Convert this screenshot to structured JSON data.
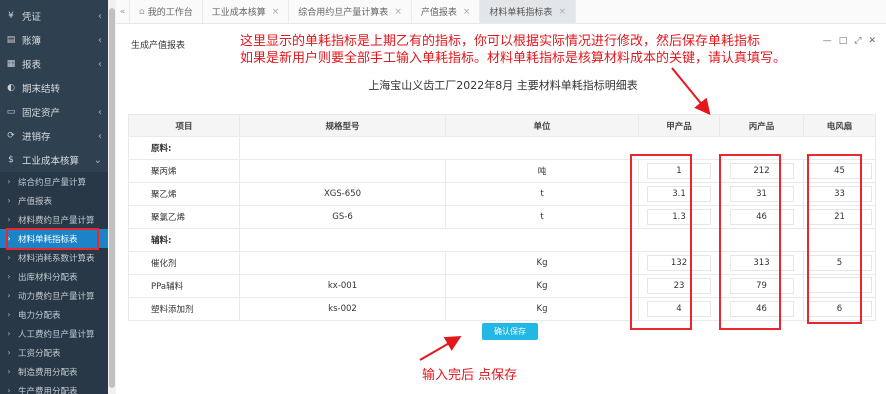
{
  "sidebar": {
    "top_items": [
      {
        "label": "凭证",
        "icon": "¥",
        "icon_name": "yen-icon"
      },
      {
        "label": "账簿",
        "icon": "▤",
        "icon_name": "book-icon"
      },
      {
        "label": "报表",
        "icon": "▦",
        "icon_name": "report-icon"
      },
      {
        "label": "期末结转",
        "icon": "◐",
        "icon_name": "period-close-icon"
      },
      {
        "label": "固定资产",
        "icon": "▭",
        "icon_name": "fixed-asset-icon"
      },
      {
        "label": "进销存",
        "icon": "⟳",
        "icon_name": "inventory-icon"
      },
      {
        "label": "工业成本核算",
        "icon": "$",
        "icon_name": "dollar-icon"
      }
    ],
    "sub_items": [
      "综合约旦产量计算",
      "产值报表",
      "材料费约旦产量计算",
      "材料单耗指标表",
      "材料消耗系数计算表",
      "出库材料分配表",
      "动力费约旦产量计算",
      "电力分配表",
      "人工费约旦产量计算",
      "工资分配表",
      "制造费用分配表",
      "生产费用分配表"
    ]
  },
  "tabs": [
    {
      "label": "我的工作台"
    },
    {
      "label": "工业成本核算"
    },
    {
      "label": "综合用约旦产量计算表"
    },
    {
      "label": "产值报表"
    },
    {
      "label": "材料单耗指标表"
    }
  ],
  "panel": {
    "title": "生成产值报表",
    "report_title": "上海宝山义齿工厂2022年8月 主要材料单耗指标明细表",
    "tools": [
      "—",
      "□",
      "⤢",
      "✕"
    ]
  },
  "table": {
    "headers": [
      "项目",
      "规格型号",
      "单位",
      "甲产品",
      "丙产品",
      "电风扇"
    ],
    "sections": [
      {
        "label": "原料:",
        "rows": [
          {
            "name": "聚丙烯",
            "spec": "",
            "unit": "吨",
            "values": [
              "1",
              "212",
              "45"
            ]
          },
          {
            "name": "聚乙烯",
            "spec": "XGS-650",
            "unit": "t",
            "values": [
              "3.1",
              "31",
              "33"
            ]
          },
          {
            "name": "聚氯乙烯",
            "spec": "GS-6",
            "unit": "t",
            "values": [
              "1.3",
              "46",
              "21"
            ]
          }
        ]
      },
      {
        "label": "辅料:",
        "rows": [
          {
            "name": "催化剂",
            "spec": "",
            "unit": "Kg",
            "values": [
              "132",
              "313",
              "5"
            ]
          },
          {
            "name": "PPa辅料",
            "spec": "kx-001",
            "unit": "Kg",
            "values": [
              "23",
              "79",
              ""
            ]
          },
          {
            "name": "塑料添加剂",
            "spec": "ks-002",
            "unit": "Kg",
            "values": [
              "4",
              "46",
              "6"
            ]
          }
        ]
      }
    ]
  },
  "save_button": "确认保存",
  "annotations": {
    "top_line1": "这里显示的单耗指标是上期乙有的指标，你可以根据实际情况进行修改，然后保存单耗指标",
    "top_line2": "如果是新用户则要全部手工输入单耗指标。材料单耗指标是核算材料成本的关键，请认真填写。",
    "bottom": "输入完后  点保存"
  },
  "colors": {
    "sidebar_bg": "#2f4050",
    "active_blue": "#1c84c6",
    "annotation_red": "#e3171c",
    "button_blue": "#23b7e5"
  }
}
